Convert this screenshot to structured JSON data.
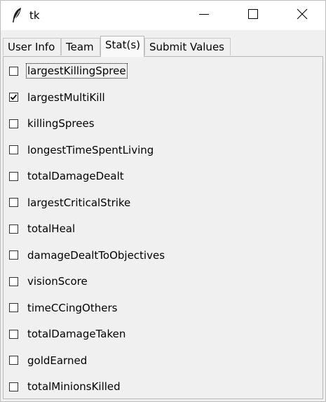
{
  "window": {
    "title": "tk"
  },
  "tabs": [
    {
      "label": "User Info",
      "selected": false
    },
    {
      "label": "Team",
      "selected": false
    },
    {
      "label": "Stat(s)",
      "selected": true
    },
    {
      "label": "Submit Values",
      "selected": false
    }
  ],
  "stats": [
    {
      "label": "largestKillingSpree",
      "checked": false,
      "focused": true
    },
    {
      "label": "largestMultiKill",
      "checked": true,
      "focused": false
    },
    {
      "label": "killingSprees",
      "checked": false,
      "focused": false
    },
    {
      "label": "longestTimeSpentLiving",
      "checked": false,
      "focused": false
    },
    {
      "label": "totalDamageDealt",
      "checked": false,
      "focused": false
    },
    {
      "label": "largestCriticalStrike",
      "checked": false,
      "focused": false
    },
    {
      "label": "totalHeal",
      "checked": false,
      "focused": false
    },
    {
      "label": "damageDealtToObjectives",
      "checked": false,
      "focused": false
    },
    {
      "label": "visionScore",
      "checked": false,
      "focused": false
    },
    {
      "label": "timeCCingOthers",
      "checked": false,
      "focused": false
    },
    {
      "label": "totalDamageTaken",
      "checked": false,
      "focused": false
    },
    {
      "label": "goldEarned",
      "checked": false,
      "focused": false
    },
    {
      "label": "totalMinionsKilled",
      "checked": false,
      "focused": false
    }
  ],
  "icons": {
    "app": "feather-icon",
    "minimize": "minimize-icon",
    "maximize": "maximize-icon",
    "close": "close-icon",
    "check": "checkmark-icon"
  }
}
